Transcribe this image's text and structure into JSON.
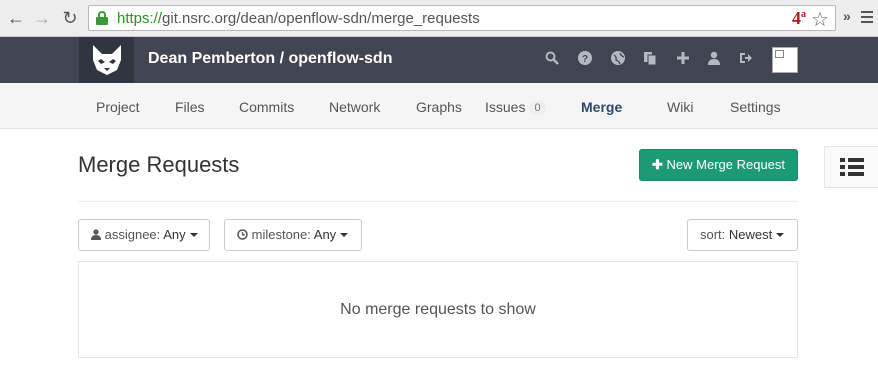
{
  "browser": {
    "url_scheme": "https://",
    "url_host_path": "git.nsrc.org/dean/openflow-sdn/merge_requests",
    "ext_badge": "4",
    "ext_badge_sup": "a",
    "overflow": "»"
  },
  "header": {
    "project_title": "Dean Pemberton / openflow-sdn",
    "icons": [
      "search-icon",
      "help-icon",
      "globe-icon",
      "copy-icon",
      "plus-icon",
      "user-icon",
      "sign-out-icon"
    ]
  },
  "project_nav": {
    "items": [
      {
        "label": "Project"
      },
      {
        "label": "Files"
      },
      {
        "label": "Commits"
      },
      {
        "label": "Network"
      },
      {
        "label": "Graphs"
      },
      {
        "label": "Issues",
        "count": "0"
      },
      {
        "label": "Merge",
        "active": true
      },
      {
        "label": "Wiki"
      },
      {
        "label": "Settings"
      }
    ]
  },
  "main": {
    "title": "Merge Requests",
    "new_button_label": "New Merge Request",
    "filters": {
      "assignee_label": "assignee:",
      "assignee_value": "Any",
      "milestone_label": "milestone:",
      "milestone_value": "Any",
      "sort_label": "sort:",
      "sort_value": "Newest"
    },
    "empty_message": "No merge requests to show"
  },
  "colors": {
    "header_bg": "#404551",
    "accent_green": "#1c9a74",
    "active_nav": "#2d4a6e"
  }
}
